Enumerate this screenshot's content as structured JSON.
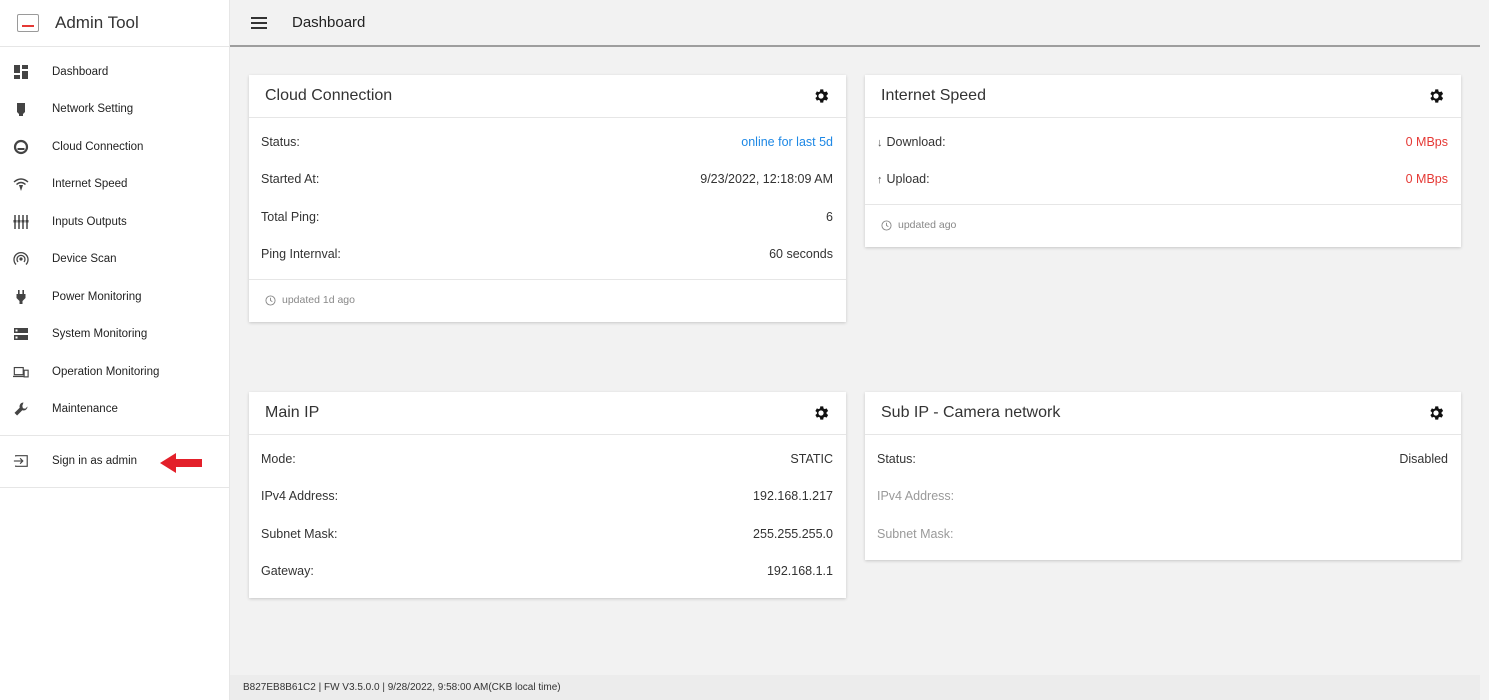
{
  "app": {
    "title": "Admin Tool"
  },
  "header": {
    "title": "Dashboard"
  },
  "sidebar": {
    "items": [
      {
        "label": "Dashboard",
        "icon": "dashboard-icon"
      },
      {
        "label": "Network Setting",
        "icon": "ethernet-icon"
      },
      {
        "label": "Cloud Connection",
        "icon": "cloud-icon"
      },
      {
        "label": "Internet Speed",
        "icon": "wifi-icon"
      },
      {
        "label": "Inputs Outputs",
        "icon": "sliders-icon"
      },
      {
        "label": "Device Scan",
        "icon": "radar-icon"
      },
      {
        "label": "Power Monitoring",
        "icon": "plug-icon"
      },
      {
        "label": "System Monitoring",
        "icon": "storage-icon"
      },
      {
        "label": "Operation Monitoring",
        "icon": "devices-icon"
      },
      {
        "label": "Maintenance",
        "icon": "wrench-icon"
      }
    ],
    "signin": {
      "label": "Sign in as admin",
      "icon": "login-icon"
    }
  },
  "cards": {
    "cloud": {
      "title": "Cloud Connection",
      "rows": [
        {
          "label": "Status:",
          "value": "online for last 5d"
        },
        {
          "label": "Started At:",
          "value": "9/23/2022, 12:18:09 AM"
        },
        {
          "label": "Total Ping:",
          "value": "6"
        },
        {
          "label": "Ping Internval:",
          "value": "60 seconds"
        }
      ],
      "footer": "updated 1d ago"
    },
    "speed": {
      "title": "Internet Speed",
      "rows": [
        {
          "label": "Download:",
          "value": "0 MBps",
          "arrow": "↓"
        },
        {
          "label": "Upload:",
          "value": "0 MBps",
          "arrow": "↑"
        }
      ],
      "footer": "updated ago"
    },
    "mainip": {
      "title": "Main IP",
      "rows": [
        {
          "label": "Mode:",
          "value": "STATIC"
        },
        {
          "label": "IPv4 Address:",
          "value": "192.168.1.217"
        },
        {
          "label": "Subnet Mask:",
          "value": "255.255.255.0"
        },
        {
          "label": "Gateway:",
          "value": "192.168.1.1"
        }
      ]
    },
    "subip": {
      "title": "Sub IP - Camera network",
      "rows": [
        {
          "label": "Status:",
          "value": "Disabled"
        },
        {
          "label": "IPv4 Address:",
          "value": ""
        },
        {
          "label": "Subnet Mask:",
          "value": ""
        }
      ]
    }
  },
  "footer": {
    "text": "B827EB8B61C2 | FW V3.5.0.0 | 9/28/2022, 9:58:00 AM(CKB local time)"
  },
  "colors": {
    "link": "#1e88e5",
    "alert": "#e53935",
    "annotation_arrow": "#e3202a"
  }
}
